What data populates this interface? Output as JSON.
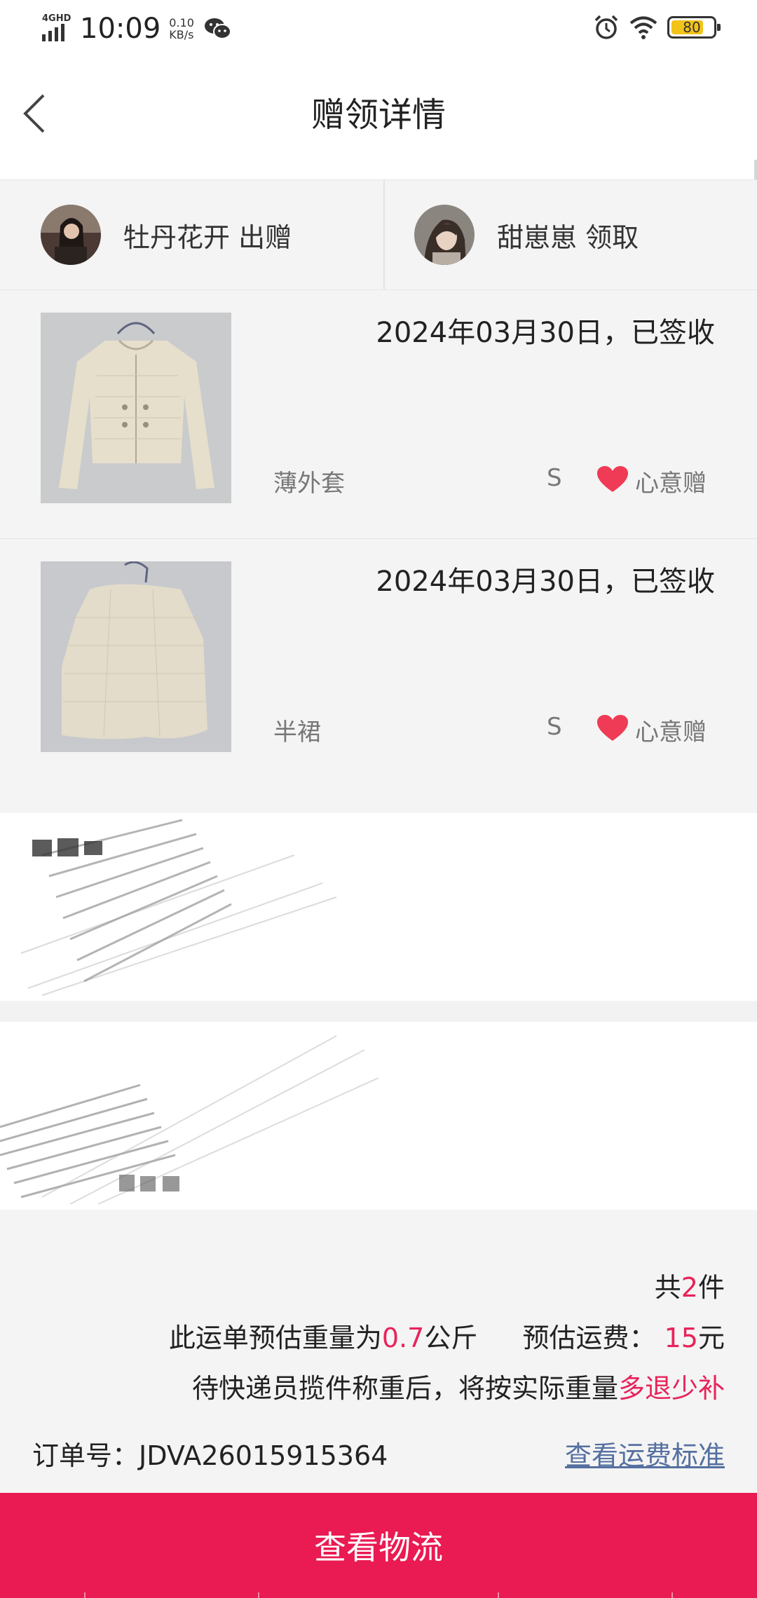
{
  "status_bar": {
    "network": "4GHD",
    "time": "10:09",
    "speed_value": "0.10",
    "speed_unit": "KB/s",
    "battery": "80",
    "battery_level": 0.8
  },
  "header": {
    "title": "赠领详情"
  },
  "parties": {
    "giver": {
      "label": "牡丹花开 出赠"
    },
    "receiver": {
      "label": "甜崽崽 领取"
    }
  },
  "items": [
    {
      "date_status": "2024年03月30日，已签收",
      "name": "薄外套",
      "size": "S",
      "tag": "心意赠"
    },
    {
      "date_status": "2024年03月30日，已签收",
      "name": "半裙",
      "size": "S",
      "tag": "心意赠"
    }
  ],
  "summary": {
    "count_prefix": "共",
    "count": "2",
    "count_suffix": "件",
    "weight_prefix": "此运单预估重量为",
    "weight": "0.7",
    "weight_unit": "公斤",
    "fee_label": "预估运费：",
    "fee": "15",
    "fee_unit": "元",
    "note_prefix": "待快递员揽件称重后，将按实际重量",
    "note_highlight": "多退少补",
    "order_label": "订单号：",
    "order_no": "JDVA26015915364",
    "fee_standard_link": "查看运费标准"
  },
  "actions": {
    "view_logistics": "查看物流"
  },
  "colors": {
    "accent": "#ea1a52",
    "highlight": "#e8235a",
    "link": "#5570a0",
    "heart": "#ef3b55",
    "battery": "#f2c318"
  }
}
